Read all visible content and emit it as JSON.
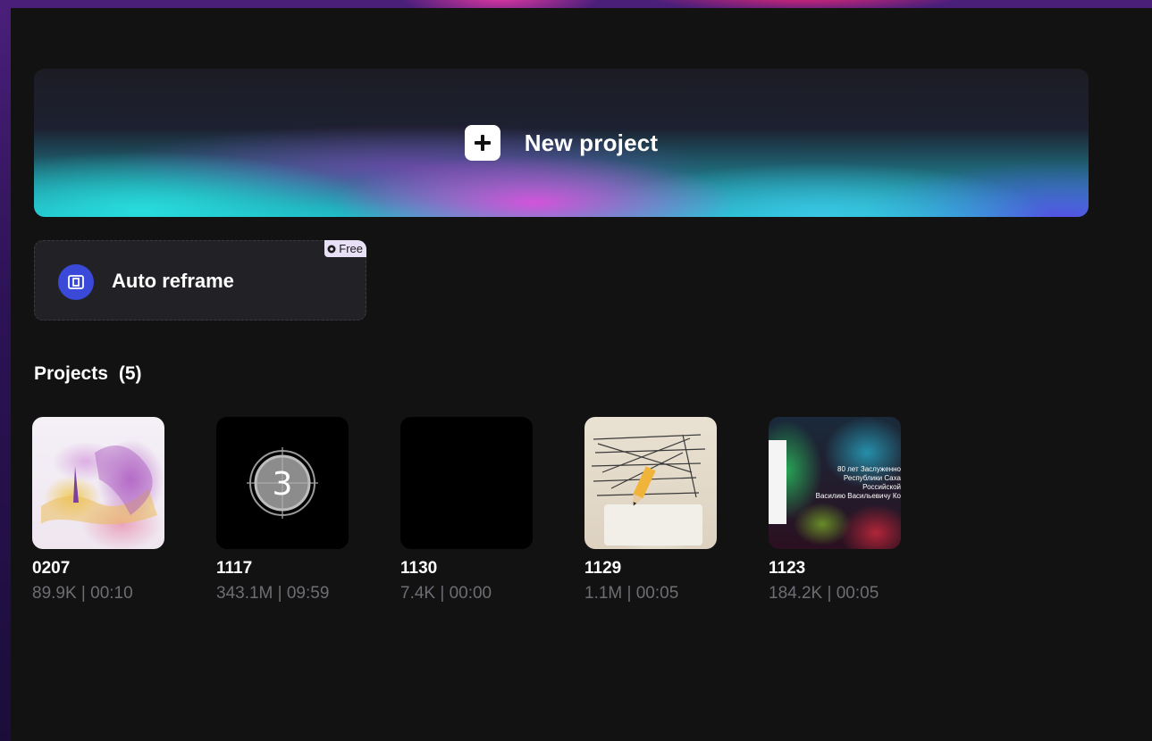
{
  "hero": {
    "label": "New project"
  },
  "auto_reframe": {
    "label": "Auto reframe",
    "badge": "Free"
  },
  "projects": {
    "title": "Projects",
    "count": "(5)",
    "items": [
      {
        "name": "0207",
        "meta": "89.9K | 00:10",
        "thumb": "watercolor-art"
      },
      {
        "name": "1117",
        "meta": "343.1M | 09:59",
        "thumb": "countdown-reel",
        "countdown": "3"
      },
      {
        "name": "1130",
        "meta": "7.4K | 00:00",
        "thumb": "black"
      },
      {
        "name": "1129",
        "meta": "1.1M | 00:05",
        "thumb": "paper-pencil"
      },
      {
        "name": "1123",
        "meta": "184.2K | 00:05",
        "thumb": "colorful-poster",
        "caption": [
          "80 лет Заслуженно",
          "Республики Саха",
          "Российской",
          "Василию Васильевичу Ко"
        ]
      }
    ]
  },
  "colors": {
    "panel": "#121212",
    "accent_blue": "#3b49d8",
    "meta_text": "#6d6d73"
  }
}
